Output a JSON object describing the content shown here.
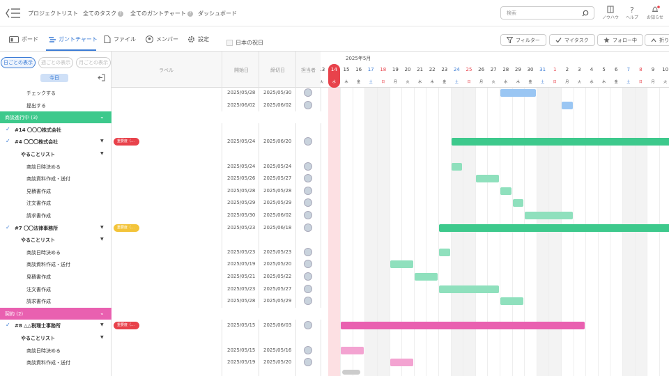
{
  "nav": {
    "items": [
      "プロジェクトリスト",
      "全てのタスク",
      "全てのガントチャート",
      "ダッシュボード"
    ]
  },
  "search": {
    "placeholder": "検索"
  },
  "top_icons": {
    "knowhow": "ノウハウ",
    "help": "ヘルプ",
    "notify": "お知らせ"
  },
  "tabs": {
    "board": "ボード",
    "gantt": "ガントチャート",
    "file": "ファイル",
    "member": "メンバー",
    "settings": "設定"
  },
  "holiday": {
    "label": "日本の祝日"
  },
  "pills": {
    "filter": "フィルター",
    "mytask": "マイタスク",
    "follow": "フォロー中",
    "fold": "折り"
  },
  "view": {
    "day": "日ごとの表示",
    "week": "週ごとの表示",
    "month": "月ごとの表示",
    "today": "今日"
  },
  "columns": {
    "label": "ラベル",
    "start": "開始日",
    "end": "締切日",
    "assignee": "担当者"
  },
  "month_label": "2025年5月",
  "days": [
    {
      "d": "13",
      "w": "火"
    },
    {
      "d": "14",
      "w": "水"
    },
    {
      "d": "15",
      "w": "木"
    },
    {
      "d": "16",
      "w": "金"
    },
    {
      "d": "17",
      "w": "土"
    },
    {
      "d": "18",
      "w": "日"
    },
    {
      "d": "19",
      "w": "月"
    },
    {
      "d": "20",
      "w": "火"
    },
    {
      "d": "21",
      "w": "水"
    },
    {
      "d": "22",
      "w": "木"
    },
    {
      "d": "23",
      "w": "金"
    },
    {
      "d": "24",
      "w": "土"
    },
    {
      "d": "25",
      "w": "日"
    },
    {
      "d": "26",
      "w": "月"
    },
    {
      "d": "27",
      "w": "火"
    },
    {
      "d": "28",
      "w": "水"
    },
    {
      "d": "29",
      "w": "木"
    },
    {
      "d": "30",
      "w": "金"
    },
    {
      "d": "31",
      "w": "土"
    },
    {
      "d": "1",
      "w": "日"
    },
    {
      "d": "2",
      "w": "月"
    },
    {
      "d": "3",
      "w": "火"
    },
    {
      "d": "4",
      "w": "水"
    },
    {
      "d": "5",
      "w": "木"
    },
    {
      "d": "6",
      "w": "金"
    },
    {
      "d": "7",
      "w": "土"
    },
    {
      "d": "8",
      "w": "日"
    },
    {
      "d": "9",
      "w": "月"
    },
    {
      "d": "10",
      "w": "火"
    }
  ],
  "today_index": 1,
  "colors": {
    "accent": "#3a7bd5",
    "green": "#3dc98c",
    "green_light": "#8fe0bd",
    "pink": "#e960b0",
    "pink_light": "#f3a3d1",
    "blue_light": "#9ac6f3",
    "today": "#e8424b"
  },
  "rows": [
    {
      "type": "task",
      "name": "チェックする",
      "start": "2025/05/28",
      "end": "2025/05/30",
      "bar": {
        "from": 15,
        "to": 17,
        "color": "blue_light"
      }
    },
    {
      "type": "task",
      "name": "提出する",
      "start": "2025/06/02",
      "end": "2025/06/02",
      "bar": {
        "from": 20,
        "to": 20,
        "color": "blue_light"
      }
    },
    {
      "type": "group",
      "name": "商談進行中 (3)",
      "color": "#3dc98c"
    },
    {
      "type": "deal",
      "name": "#14 〇〇〇株式会社",
      "checked": true
    },
    {
      "type": "deal",
      "name": "#4 〇〇〇株式会社",
      "checked": true,
      "caret": true,
      "badge": "重要度（…",
      "badge_color": "#e8424b",
      "start": "2025/05/24",
      "end": "2025/06/20",
      "bar": {
        "from": 11,
        "to": 29,
        "color": "green"
      }
    },
    {
      "type": "list",
      "name": "やることリスト",
      "caret": true
    },
    {
      "type": "task",
      "name": "商談日時決める",
      "start": "2025/05/24",
      "end": "2025/05/24",
      "bar": {
        "from": 11,
        "to": 11,
        "color": "green_light"
      }
    },
    {
      "type": "task",
      "name": "商談資料作成・送付",
      "start": "2025/05/26",
      "end": "2025/05/27",
      "bar": {
        "from": 13,
        "to": 14,
        "color": "green_light"
      }
    },
    {
      "type": "task",
      "name": "見積書作成",
      "start": "2025/05/28",
      "end": "2025/05/28",
      "bar": {
        "from": 15,
        "to": 15,
        "color": "green_light"
      }
    },
    {
      "type": "task",
      "name": "注文書作成",
      "start": "2025/05/29",
      "end": "2025/05/29",
      "bar": {
        "from": 16,
        "to": 16,
        "color": "green_light"
      }
    },
    {
      "type": "task",
      "name": "請求書作成",
      "start": "2025/05/30",
      "end": "2025/06/02",
      "bar": {
        "from": 17,
        "to": 20,
        "color": "green_light"
      }
    },
    {
      "type": "deal",
      "name": "#7 〇〇法律事務所",
      "checked": true,
      "caret": true,
      "badge": "重要度（…",
      "badge_color": "#f3c43a",
      "start": "2025/05/23",
      "end": "2025/06/18",
      "bar": {
        "from": 10,
        "to": 29,
        "color": "green"
      }
    },
    {
      "type": "list",
      "name": "やることリスト",
      "caret": true
    },
    {
      "type": "task",
      "name": "商談日時決める",
      "start": "2025/05/23",
      "end": "2025/05/23",
      "bar": {
        "from": 10,
        "to": 10,
        "color": "green_light"
      }
    },
    {
      "type": "task",
      "name": "商談資料作成・送付",
      "start": "2025/05/19",
      "end": "2025/05/20",
      "bar": {
        "from": 6,
        "to": 7,
        "color": "green_light"
      }
    },
    {
      "type": "task",
      "name": "見積書作成",
      "start": "2025/05/21",
      "end": "2025/05/22",
      "bar": {
        "from": 8,
        "to": 9,
        "color": "green_light"
      }
    },
    {
      "type": "task",
      "name": "注文書作成",
      "start": "2025/05/23",
      "end": "2025/05/27",
      "bar": {
        "from": 10,
        "to": 14,
        "color": "green_light"
      }
    },
    {
      "type": "task",
      "name": "請求書作成",
      "start": "2025/05/28",
      "end": "2025/05/29",
      "bar": {
        "from": 15,
        "to": 16,
        "color": "green_light"
      }
    },
    {
      "type": "group",
      "name": "契約 (2)",
      "color": "#e960b0"
    },
    {
      "type": "deal",
      "name": "#8 △△税理士事務所",
      "checked": true,
      "caret": true,
      "badge": "重要度（…",
      "badge_color": "#e8424b",
      "start": "2025/05/15",
      "end": "2025/06/03",
      "bar": {
        "from": 2,
        "to": 21,
        "color": "pink"
      }
    },
    {
      "type": "list",
      "name": "やることリスト",
      "caret": true
    },
    {
      "type": "task",
      "name": "商談日時決める",
      "start": "2025/05/15",
      "end": "2025/05/16",
      "bar": {
        "from": 2,
        "to": 3,
        "color": "pink_light"
      }
    },
    {
      "type": "task",
      "name": "商談資料作成・送付",
      "start": "2025/05/19",
      "end": "2025/05/20",
      "bar": {
        "from": 6,
        "to": 7,
        "color": "pink_light"
      }
    }
  ]
}
